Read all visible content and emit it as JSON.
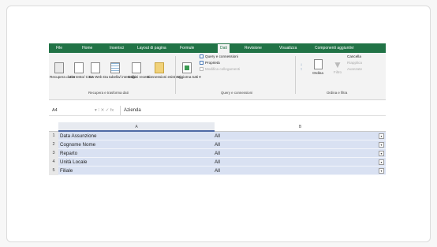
{
  "tabs": [
    "File",
    "Home",
    "Inserisci",
    "Layout di pagina",
    "Formule",
    "Dati",
    "Revisione",
    "Visualizza",
    "Componenti aggiuntivi"
  ],
  "active_tab": "Dati",
  "ribbon": {
    "recupera_dati": "Recupera dati ▾",
    "da_testo_csv": "Da testo/ CSV",
    "da_web": "Da Web",
    "da_tabella": "Da tabella/ intervallo",
    "origini_recenti": "Origini recenti",
    "connessioni_esistenti": "Connessioni esistenti",
    "aggiorna_tutti": "Aggiorna tutti ▾",
    "query_connessioni": "Query e connessioni",
    "proprieta": "Proprietà",
    "modifica_collegamenti": "Modifica collegamenti",
    "ordina": "Ordina",
    "filtro": "Filtro",
    "cancella": "Cancella",
    "riapplica": "Riapplica",
    "avanzate": "Avanzate",
    "group_recupera": "Recupera e trasforma dati",
    "group_query": "Query e connessioni",
    "group_ordina": "Ordina e filtra"
  },
  "formula_bar": {
    "name_box": "A4",
    "icons": "▾  ⁝   ✕   ✓   fx",
    "content": "Azienda"
  },
  "columns": {
    "a": "A",
    "b": "B"
  },
  "rows": [
    {
      "num": "1",
      "a": "Data Assunzione",
      "b": "All"
    },
    {
      "num": "2",
      "a": "Cognome Nome",
      "b": "All"
    },
    {
      "num": "3",
      "a": "Reparto",
      "b": "All"
    },
    {
      "num": "4",
      "a": "Unità Locale",
      "b": "All"
    },
    {
      "num": "5",
      "a": "Filiale",
      "b": "All"
    }
  ],
  "dropdown_glyph": "▾",
  "colors": {
    "excel_green": "#217346",
    "selection": "#d9e1f2"
  }
}
